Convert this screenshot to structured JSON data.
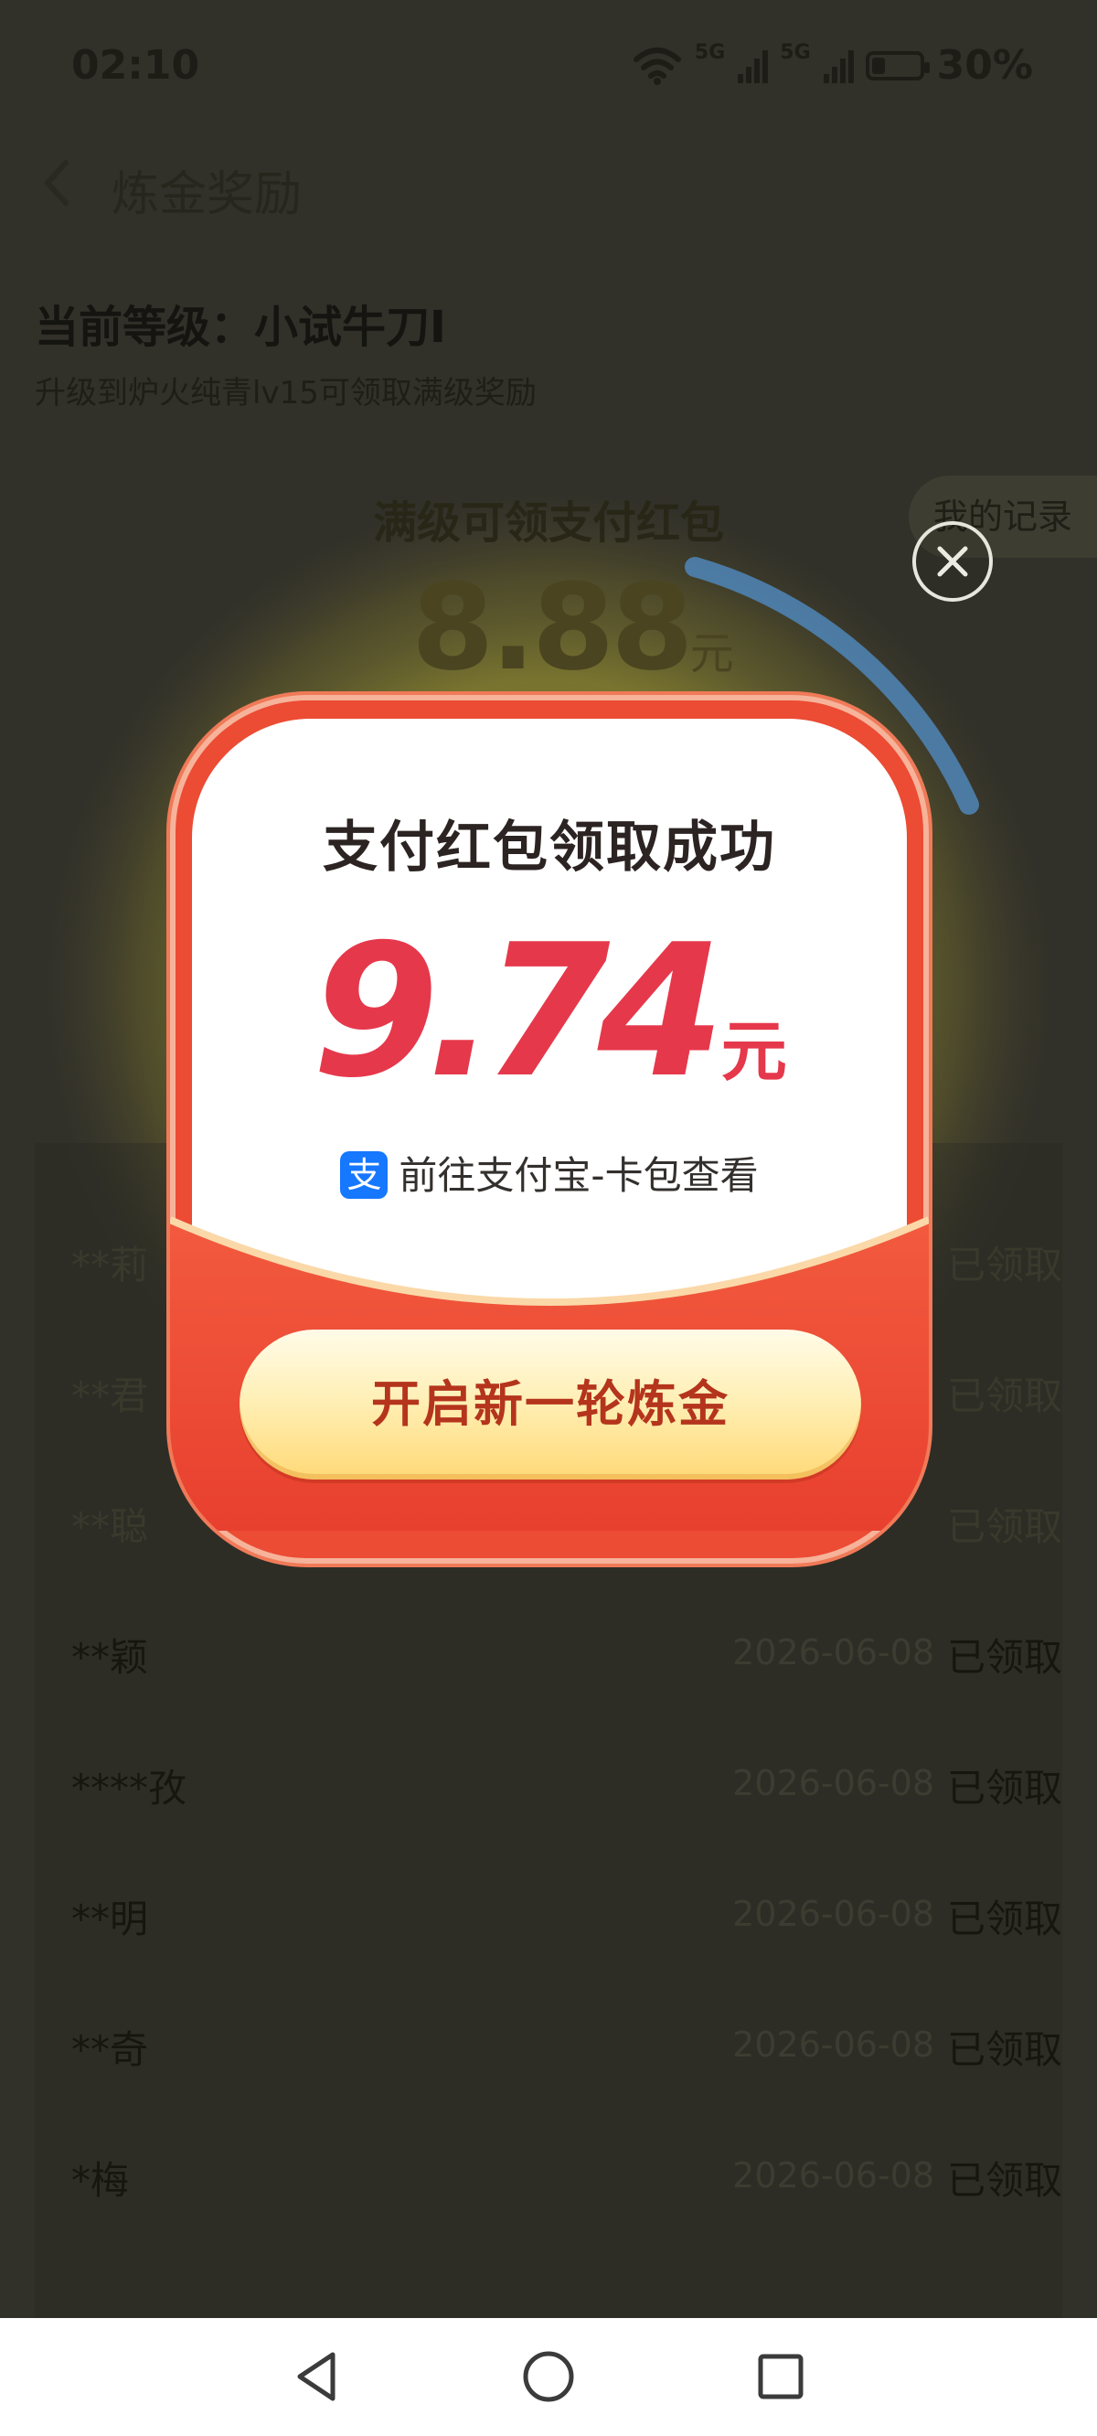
{
  "status_bar": {
    "time": "02:10",
    "signal_1": "5G",
    "signal_2": "5G",
    "battery": "30%",
    "icons": [
      "wifi-icon",
      "signal-icon",
      "signal-icon",
      "battery-icon"
    ]
  },
  "header": {
    "title": "炼金奖励",
    "back_icon": "chevron-left-icon"
  },
  "level": {
    "title": "当前等级：小试牛刀I",
    "subtitle": "升级到炉火纯青lv15可领取满级奖励"
  },
  "reward_card": {
    "label": "满级可领支付红包",
    "amount": "8.88",
    "unit": "元",
    "records_tab": "我的记录"
  },
  "records": [
    {
      "name": "**莉",
      "date": "",
      "status": "已领取"
    },
    {
      "name": "**君",
      "date": "",
      "status": "已领取"
    },
    {
      "name": "**聪",
      "date": "",
      "status": "已领取"
    },
    {
      "name": "**颖",
      "date": "2026-06-08",
      "status": "已领取"
    },
    {
      "name": "****孜",
      "date": "2026-06-08",
      "status": "已领取"
    },
    {
      "name": "**明",
      "date": "2026-06-08",
      "status": "已领取"
    },
    {
      "name": "**奇",
      "date": "2026-06-08",
      "status": "已领取"
    },
    {
      "name": "*梅",
      "date": "2026-06-08",
      "status": "已领取"
    }
  ],
  "modal": {
    "title": "支付红包领取成功",
    "amount": "9.74",
    "unit": "元",
    "alipay_icon_glyph": "支",
    "alipay_link": "前往支付宝-卡包查看",
    "cta_label": "开启新一轮炼金",
    "close_icon": "close-icon"
  },
  "nav_bar": {
    "icons": [
      "back-triangle-icon",
      "home-circle-icon",
      "recents-square-icon"
    ]
  },
  "colors": {
    "modal_red": "#ec4b34",
    "amount_red": "#e6384b",
    "cta_text": "#b4341c",
    "alipay_blue": "#1677ff"
  }
}
